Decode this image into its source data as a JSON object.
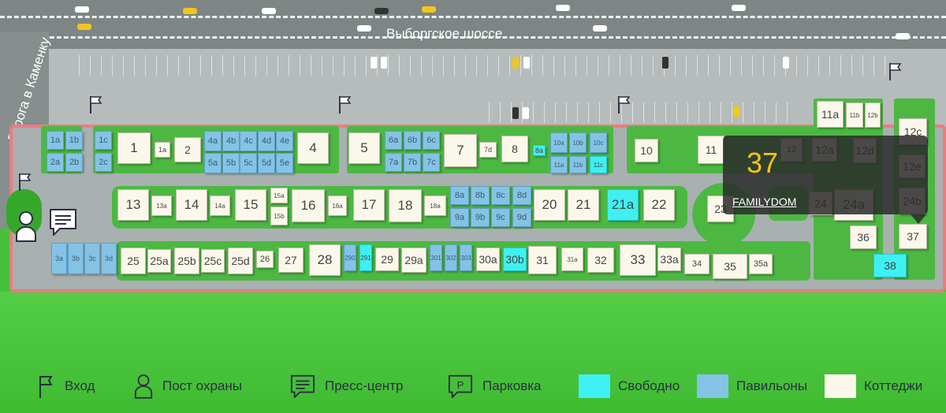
{
  "roads": {
    "highway": "Выборгское шоссе",
    "side_road": "Дорога в Каменку"
  },
  "colors": {
    "cottage": "#fbf8eb",
    "pavilion": "#84c3e6",
    "free": "#3ff0f2",
    "border": "#ee7a80",
    "tooltip_number": "#f5c518"
  },
  "tooltip": {
    "number": "37",
    "name": "FAMILYDOM"
  },
  "legend": {
    "entrance": "Вход",
    "security": "Пост охраны",
    "press_center": "Пресс-центр",
    "parking": "Парковка",
    "parking_symbol": "P",
    "free": "Свободно",
    "pavilions": "Павильоны",
    "cottages": "Коттеджи"
  },
  "icons": [
    "flag-icon",
    "person-icon",
    "chat-bubble-icon",
    "parking-icon"
  ],
  "plots": [
    {
      "id": "1a",
      "type": "pavilion"
    },
    {
      "id": "1b",
      "type": "pavilion"
    },
    {
      "id": "2a",
      "type": "pavilion"
    },
    {
      "id": "2b",
      "type": "pavilion"
    },
    {
      "id": "1c",
      "type": "pavilion"
    },
    {
      "id": "2c",
      "type": "pavilion"
    },
    {
      "id": "1",
      "type": "cottage"
    },
    {
      "id": "1a",
      "type": "cottage"
    },
    {
      "id": "2",
      "type": "cottage"
    },
    {
      "id": "4a",
      "type": "pavilion"
    },
    {
      "id": "4b",
      "type": "pavilion"
    },
    {
      "id": "4c",
      "type": "pavilion"
    },
    {
      "id": "4d",
      "type": "pavilion"
    },
    {
      "id": "4e",
      "type": "pavilion"
    },
    {
      "id": "5a",
      "type": "pavilion"
    },
    {
      "id": "5b",
      "type": "pavilion"
    },
    {
      "id": "5c",
      "type": "pavilion"
    },
    {
      "id": "5d",
      "type": "pavilion"
    },
    {
      "id": "5e",
      "type": "pavilion"
    },
    {
      "id": "4",
      "type": "cottage"
    },
    {
      "id": "5",
      "type": "cottage"
    },
    {
      "id": "6a",
      "type": "pavilion"
    },
    {
      "id": "6b",
      "type": "pavilion"
    },
    {
      "id": "6c",
      "type": "pavilion"
    },
    {
      "id": "7a",
      "type": "pavilion"
    },
    {
      "id": "7b",
      "type": "pavilion"
    },
    {
      "id": "7c",
      "type": "pavilion"
    },
    {
      "id": "7",
      "type": "cottage"
    },
    {
      "id": "7d",
      "type": "cottage"
    },
    {
      "id": "8",
      "type": "cottage"
    },
    {
      "id": "8a",
      "type": "free"
    },
    {
      "id": "10a",
      "type": "pavilion"
    },
    {
      "id": "10b",
      "type": "pavilion"
    },
    {
      "id": "10c",
      "type": "pavilion"
    },
    {
      "id": "11a",
      "type": "pavilion"
    },
    {
      "id": "11b",
      "type": "pavilion"
    },
    {
      "id": "11c",
      "type": "free"
    },
    {
      "id": "10",
      "type": "cottage"
    },
    {
      "id": "11",
      "type": "cottage"
    },
    {
      "id": "11a",
      "type": "cottage"
    },
    {
      "id": "11b",
      "type": "cottage"
    },
    {
      "id": "12b",
      "type": "cottage"
    },
    {
      "id": "12",
      "type": "cottage"
    },
    {
      "id": "12a",
      "type": "cottage"
    },
    {
      "id": "12d",
      "type": "cottage"
    },
    {
      "id": "12c",
      "type": "cottage"
    },
    {
      "id": "12e",
      "type": "cottage"
    },
    {
      "id": "24b",
      "type": "cottage"
    },
    {
      "id": "13",
      "type": "cottage"
    },
    {
      "id": "13a",
      "type": "cottage"
    },
    {
      "id": "14",
      "type": "cottage"
    },
    {
      "id": "14a",
      "type": "cottage"
    },
    {
      "id": "15",
      "type": "cottage"
    },
    {
      "id": "15a",
      "type": "cottage"
    },
    {
      "id": "15b",
      "type": "cottage"
    },
    {
      "id": "16",
      "type": "cottage"
    },
    {
      "id": "16a",
      "type": "cottage"
    },
    {
      "id": "17",
      "type": "cottage"
    },
    {
      "id": "18",
      "type": "cottage"
    },
    {
      "id": "18a",
      "type": "cottage"
    },
    {
      "id": "8a",
      "type": "pavilion"
    },
    {
      "id": "8b",
      "type": "pavilion"
    },
    {
      "id": "8c",
      "type": "pavilion"
    },
    {
      "id": "8d",
      "type": "pavilion"
    },
    {
      "id": "9a",
      "type": "pavilion"
    },
    {
      "id": "9b",
      "type": "pavilion"
    },
    {
      "id": "9c",
      "type": "pavilion"
    },
    {
      "id": "9d",
      "type": "pavilion"
    },
    {
      "id": "20",
      "type": "cottage"
    },
    {
      "id": "21",
      "type": "cottage"
    },
    {
      "id": "21a",
      "type": "free"
    },
    {
      "id": "22",
      "type": "cottage"
    },
    {
      "id": "23",
      "type": "cottage"
    },
    {
      "id": "24",
      "type": "cottage"
    },
    {
      "id": "24a",
      "type": "cottage"
    },
    {
      "id": "36",
      "type": "cottage"
    },
    {
      "id": "37",
      "type": "cottage"
    },
    {
      "id": "38",
      "type": "free"
    },
    {
      "id": "3a",
      "type": "pavilion"
    },
    {
      "id": "3b",
      "type": "pavilion"
    },
    {
      "id": "3c",
      "type": "pavilion"
    },
    {
      "id": "3d",
      "type": "pavilion"
    },
    {
      "id": "25",
      "type": "cottage"
    },
    {
      "id": "25a",
      "type": "cottage"
    },
    {
      "id": "25b",
      "type": "cottage"
    },
    {
      "id": "25c",
      "type": "cottage"
    },
    {
      "id": "25d",
      "type": "cottage"
    },
    {
      "id": "26",
      "type": "cottage"
    },
    {
      "id": "27",
      "type": "cottage"
    },
    {
      "id": "28",
      "type": "cottage"
    },
    {
      "id": "290",
      "type": "pavilion"
    },
    {
      "id": "291",
      "type": "free"
    },
    {
      "id": "29",
      "type": "cottage"
    },
    {
      "id": "29a",
      "type": "cottage"
    },
    {
      "id": "301",
      "type": "pavilion"
    },
    {
      "id": "302",
      "type": "pavilion"
    },
    {
      "id": "303",
      "type": "pavilion"
    },
    {
      "id": "30a",
      "type": "cottage"
    },
    {
      "id": "30b",
      "type": "free"
    },
    {
      "id": "31",
      "type": "cottage"
    },
    {
      "id": "31a",
      "type": "cottage"
    },
    {
      "id": "32",
      "type": "cottage"
    },
    {
      "id": "33",
      "type": "cottage"
    },
    {
      "id": "33a",
      "type": "cottage"
    },
    {
      "id": "34",
      "type": "cottage"
    },
    {
      "id": "35",
      "type": "cottage"
    },
    {
      "id": "35a",
      "type": "cottage"
    }
  ]
}
